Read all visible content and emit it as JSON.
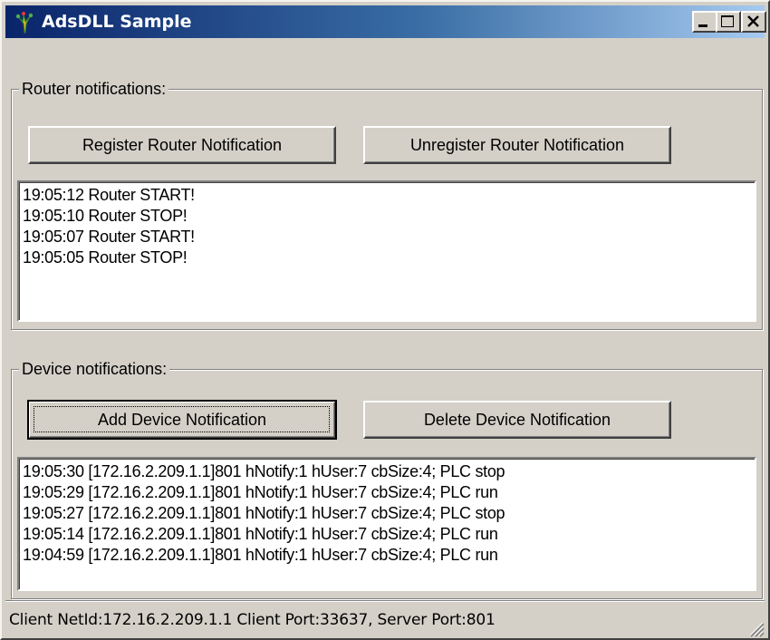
{
  "window": {
    "title": "AdsDLL Sample",
    "icon": "ads-app-icon"
  },
  "caption_buttons": {
    "minimize": "minimize-icon",
    "maximize": "maximize-icon",
    "close": "close-icon"
  },
  "router_group": {
    "legend": "Router notifications:",
    "register_label": "Register Router Notification",
    "unregister_label": "Unregister Router Notification",
    "log": [
      "19:05:12 Router START!",
      "19:05:10 Router STOP!",
      "19:05:07 Router START!",
      "19:05:05 Router STOP!"
    ]
  },
  "device_group": {
    "legend": "Device notifications:",
    "add_label": "Add Device Notification",
    "delete_label": "Delete Device Notification",
    "log": [
      "19:05:30 [172.16.2.209.1.1]801 hNotify:1 hUser:7 cbSize:4; PLC stop",
      "19:05:29 [172.16.2.209.1.1]801 hNotify:1 hUser:7 cbSize:4; PLC run",
      "19:05:27 [172.16.2.209.1.1]801 hNotify:1 hUser:7 cbSize:4; PLC stop",
      "19:05:14 [172.16.2.209.1.1]801 hNotify:1 hUser:7 cbSize:4; PLC run",
      "19:04:59 [172.16.2.209.1.1]801 hNotify:1 hUser:7 cbSize:4; PLC run"
    ]
  },
  "statusbar": {
    "text": "Client NetId:172.16.2.209.1.1  Client Port:33637,  Server Port:801"
  },
  "colors": {
    "titlebar_start": "#0a246a",
    "titlebar_end": "#a6caf0",
    "face": "#d4d0c8"
  }
}
